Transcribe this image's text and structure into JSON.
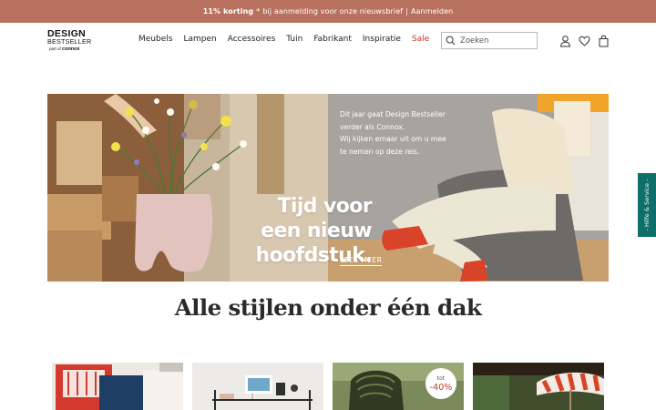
{
  "promo": {
    "discount": "11% korting",
    "asterisk": "*",
    "text": "bij aanmelding voor onze nieuwsbrief",
    "separator": "|",
    "link": "Aanmelden"
  },
  "logo": {
    "line1": "DESIGN",
    "line2": "BESTSELLER",
    "part_of": "part of",
    "brand": "connox"
  },
  "nav": {
    "items": [
      "Meubels",
      "Lampen",
      "Accessoires",
      "Tuin",
      "Fabrikant",
      "Inspiratie",
      "Sale"
    ]
  },
  "search": {
    "placeholder": "Zoeken"
  },
  "header_icons": [
    "user-icon",
    "heart-icon",
    "shopping-bag-icon"
  ],
  "hero": {
    "title_lines": [
      "Tijd voor",
      "een nieuw",
      "hoofdstuk."
    ],
    "text_lines": [
      "Dit jaar gaat Design Bestseller",
      "verder als Connox.",
      "Wij kijken ernaar uit om u mee",
      "te nemen op deze reis."
    ],
    "cta": "LEES MEER"
  },
  "section": {
    "title": "Alle stijlen onder één dak"
  },
  "tiles": [
    {
      "name": "art-prints-tile"
    },
    {
      "name": "shelving-tile"
    },
    {
      "name": "garden-chair-tile",
      "badge_prefix": "tot",
      "badge_value": "-40%"
    },
    {
      "name": "parasol-tile"
    }
  ],
  "side_tab": {
    "label": "- Hilfe & Service -"
  },
  "colors": {
    "promo_bg": "#b9715f",
    "sale": "#c0392b",
    "side_tab": "#0d6e6a"
  }
}
